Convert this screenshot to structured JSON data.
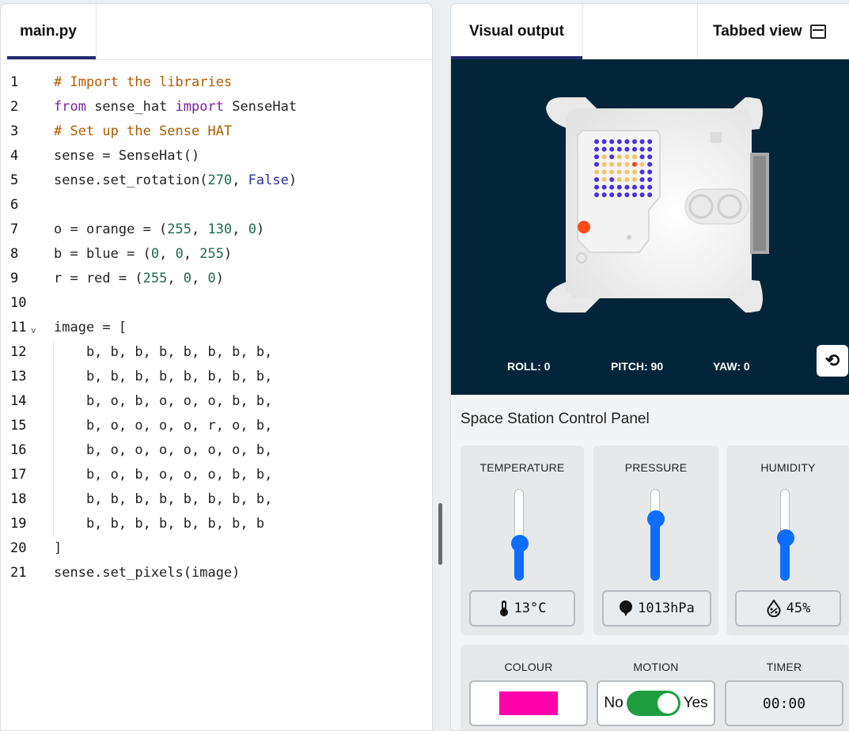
{
  "editor": {
    "tab_label": "main.py",
    "lines": [
      {
        "n": "1",
        "parts": [
          {
            "c": "t-comment",
            "t": "# Import the libraries"
          }
        ]
      },
      {
        "n": "2",
        "parts": [
          {
            "c": "t-kw",
            "t": "from"
          },
          {
            "c": "",
            "t": " sense_hat "
          },
          {
            "c": "t-kw",
            "t": "import"
          },
          {
            "c": "",
            "t": " SenseHat"
          }
        ]
      },
      {
        "n": "3",
        "parts": [
          {
            "c": "t-comment",
            "t": "# Set up the Sense HAT"
          }
        ]
      },
      {
        "n": "4",
        "parts": [
          {
            "c": "",
            "t": "sense = SenseHat()"
          }
        ]
      },
      {
        "n": "5",
        "parts": [
          {
            "c": "",
            "t": "sense.set_rotation("
          },
          {
            "c": "t-num",
            "t": "270"
          },
          {
            "c": "",
            "t": ", "
          },
          {
            "c": "t-bool",
            "t": "False"
          },
          {
            "c": "",
            "t": ")"
          }
        ]
      },
      {
        "n": "6",
        "parts": []
      },
      {
        "n": "7",
        "parts": [
          {
            "c": "",
            "t": "o = orange = ("
          },
          {
            "c": "t-num",
            "t": "255"
          },
          {
            "c": "",
            "t": ", "
          },
          {
            "c": "t-num",
            "t": "130"
          },
          {
            "c": "",
            "t": ", "
          },
          {
            "c": "t-num",
            "t": "0"
          },
          {
            "c": "",
            "t": ")"
          }
        ]
      },
      {
        "n": "8",
        "parts": [
          {
            "c": "",
            "t": "b = blue = ("
          },
          {
            "c": "t-num",
            "t": "0"
          },
          {
            "c": "",
            "t": ", "
          },
          {
            "c": "t-num",
            "t": "0"
          },
          {
            "c": "",
            "t": ", "
          },
          {
            "c": "t-num",
            "t": "255"
          },
          {
            "c": "",
            "t": ")"
          }
        ]
      },
      {
        "n": "9",
        "parts": [
          {
            "c": "",
            "t": "r = red = ("
          },
          {
            "c": "t-num",
            "t": "255"
          },
          {
            "c": "",
            "t": ", "
          },
          {
            "c": "t-num",
            "t": "0"
          },
          {
            "c": "",
            "t": ", "
          },
          {
            "c": "t-num",
            "t": "0"
          },
          {
            "c": "",
            "t": ")"
          }
        ]
      },
      {
        "n": "10",
        "parts": []
      },
      {
        "n": "11",
        "fold": "v",
        "parts": [
          {
            "c": "",
            "t": "image = ["
          }
        ]
      },
      {
        "n": "12",
        "parts": [
          {
            "c": "",
            "t": "    b, b, b, b, b, b, b, b,"
          }
        ]
      },
      {
        "n": "13",
        "parts": [
          {
            "c": "",
            "t": "    b, b, b, b, b, b, b, b,"
          }
        ]
      },
      {
        "n": "14",
        "parts": [
          {
            "c": "",
            "t": "    b, o, b, o, o, o, b, b,"
          }
        ]
      },
      {
        "n": "15",
        "parts": [
          {
            "c": "",
            "t": "    b, o, o, o, o, r, o, b,"
          }
        ]
      },
      {
        "n": "16",
        "parts": [
          {
            "c": "",
            "t": "    b, o, o, o, o, o, o, b,"
          }
        ]
      },
      {
        "n": "17",
        "parts": [
          {
            "c": "",
            "t": "    b, o, b, o, o, o, b, b,"
          }
        ]
      },
      {
        "n": "18",
        "parts": [
          {
            "c": "",
            "t": "    b, b, b, b, b, b, b, b,"
          }
        ]
      },
      {
        "n": "19",
        "parts": [
          {
            "c": "",
            "t": "    b, b, b, b, b, b, b, b"
          }
        ]
      },
      {
        "n": "20",
        "parts": [
          {
            "c": "",
            "t": "]"
          }
        ]
      },
      {
        "n": "21",
        "parts": [
          {
            "c": "",
            "t": "sense.set_pixels(image)"
          }
        ]
      }
    ]
  },
  "output": {
    "tab_label": "Visual output",
    "tabbed_view_label": "Tabbed view",
    "orientation": {
      "roll": "ROLL: 0",
      "pitch": "PITCH: 90",
      "yaw": "YAW: 0"
    },
    "led_matrix": [
      "bbbbbbbb",
      "bbbbbbbb",
      "bobooobb",
      "boooorob",
      "oooooob",
      "bobooobb",
      "bbbbbbbb",
      "bbbbbbbb"
    ],
    "led_colors": {
      "b": "#4b2de0",
      "o": "#f4c46a",
      "r": "#ff3b1f"
    }
  },
  "panel": {
    "title": "Space Station Control Panel",
    "temperature": {
      "label": "TEMPERATURE",
      "value": "13°C",
      "level": 0.37
    },
    "pressure": {
      "label": "PRESSURE",
      "value": "1013hPa",
      "level": 0.7
    },
    "humidity": {
      "label": "HUMIDITY",
      "value": "45%",
      "level": 0.45
    },
    "colour": {
      "label": "COLOUR",
      "value": "#ff00aa"
    },
    "motion": {
      "label": "MOTION",
      "off_label": "No",
      "on_label": "Yes",
      "on": true
    },
    "timer": {
      "label": "TIMER",
      "value": "00:00"
    }
  }
}
